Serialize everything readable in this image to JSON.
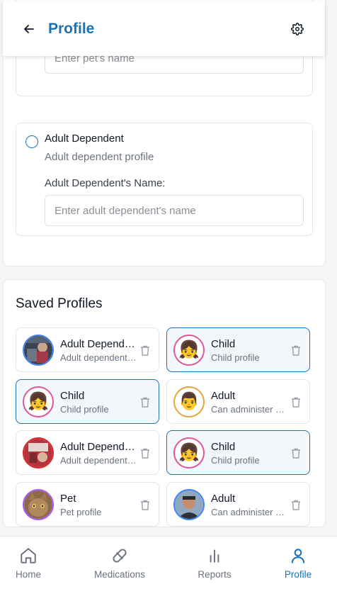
{
  "header": {
    "title": "Profile",
    "back_icon": "arrow-left-icon",
    "settings_icon": "gear-icon"
  },
  "form": {
    "pet": {
      "name_placeholder": "Enter pet's name"
    },
    "adult": {
      "title": "Adult Dependent",
      "description": "Adult dependent profile",
      "name_label": "Adult Dependent's Name:",
      "name_placeholder": "Enter adult dependent's name"
    }
  },
  "saved": {
    "title": "Saved Profiles",
    "profiles": [
      {
        "name": "Adult Dependent",
        "sub": "Adult dependent profile",
        "avatar": "photo-avatar-icon",
        "selected": false
      },
      {
        "name": "Child",
        "sub": "Child profile",
        "avatar": "girl-emoji-icon",
        "selected": true
      },
      {
        "name": "Child",
        "sub": "Child profile",
        "avatar": "girl-emoji-icon",
        "selected": true
      },
      {
        "name": "Adult",
        "sub": "Can administer medications",
        "avatar": "man-emoji-icon",
        "selected": false
      },
      {
        "name": "Adult Dependent",
        "sub": "Adult dependent profile",
        "avatar": "photo-avatar-icon",
        "selected": false
      },
      {
        "name": "Child",
        "sub": "Child profile",
        "avatar": "girl-emoji-icon",
        "selected": true
      },
      {
        "name": "Pet",
        "sub": "Pet profile",
        "avatar": "cat-photo-icon",
        "selected": false
      },
      {
        "name": "Adult",
        "sub": "Can administer medications",
        "avatar": "person-photo-icon",
        "selected": false
      }
    ]
  },
  "nav": {
    "items": [
      {
        "label": "Home",
        "icon": "home-icon"
      },
      {
        "label": "Medications",
        "icon": "pill-icon"
      },
      {
        "label": "Reports",
        "icon": "bar-chart-icon"
      },
      {
        "label": "Profile",
        "icon": "user-icon"
      }
    ],
    "active_color": "#1a73b8"
  },
  "colors": {
    "accent": "#1a73b8",
    "child_avatar_border": "#e0569b",
    "adult_avatar_border": "#e8a33a"
  }
}
